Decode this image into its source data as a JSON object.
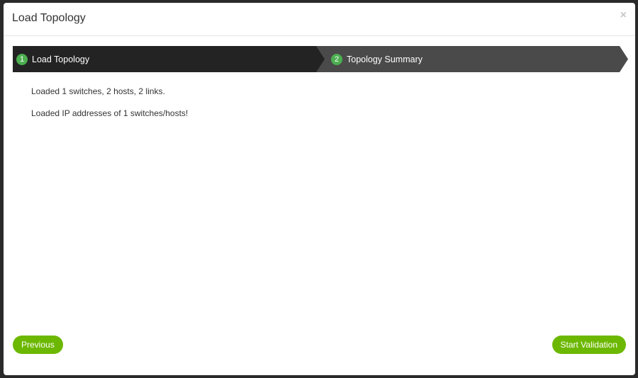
{
  "modal": {
    "title": "Load Topology",
    "close_label": "×"
  },
  "wizard": {
    "steps": [
      {
        "number": "1",
        "label": "Load Topology",
        "active": true
      },
      {
        "number": "2",
        "label": "Topology Summary",
        "active": false
      }
    ]
  },
  "messages": [
    "Loaded 1 switches, 2 hosts, 2 links.",
    "Loaded IP addresses of 1 switches/hosts!"
  ],
  "footer": {
    "previous_label": "Previous",
    "start_label": "Start Validation"
  },
  "colors": {
    "accent_green": "#6cb800",
    "step_number_green": "#4caf50",
    "active_step_bg": "#232323",
    "inactive_step_bg": "#4a4a4a"
  }
}
